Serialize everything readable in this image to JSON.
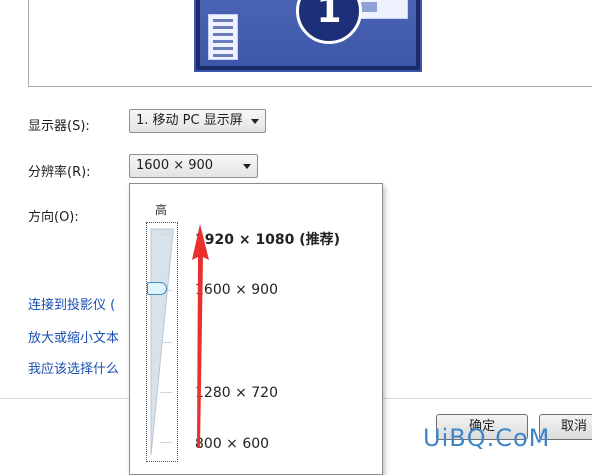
{
  "display_preview": {
    "monitor_number": "1"
  },
  "form": {
    "display_label": "显示器(S):",
    "display_value": "1. 移动 PC 显示屏",
    "resolution_label": "分辨率(R):",
    "resolution_value": "1600 × 900",
    "orientation_label": "方向(O):"
  },
  "links": {
    "projector": "连接到投影仪 (",
    "text_size": "放大或缩小文本",
    "help": "我应该选择什么"
  },
  "buttons": {
    "ok": "确定",
    "cancel": "取消"
  },
  "resolution_popup": {
    "high_label": "高",
    "options": [
      "1920 × 1080 (推荐)",
      "1600 × 900",
      "1280 × 720",
      "800 × 600"
    ],
    "selected_index": 1,
    "slider_position_fraction": 0.25
  },
  "colors": {
    "link": "#1a4fb0",
    "annotation_arrow": "#e8302f",
    "watermark": "#3d86c8"
  },
  "watermark": "UiBQ.CoM"
}
